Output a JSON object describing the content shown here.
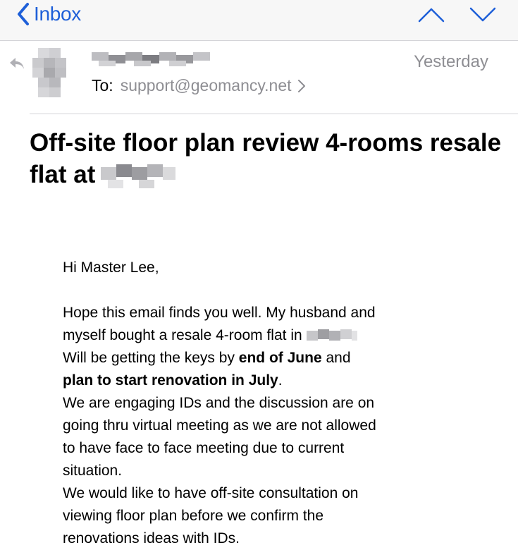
{
  "nav": {
    "back_label": "Inbox"
  },
  "header": {
    "timestamp": "Yesterday",
    "to_label": "To:",
    "to_address": "support@geomancy.net"
  },
  "subject": {
    "text": "Off-site floor plan review 4-rooms resale flat at"
  },
  "body": {
    "greeting": "Hi Master Lee,",
    "line1": "Hope this email finds you well. My husband and",
    "line2": "myself bought a resale 4-room flat in",
    "line3_pre": "Will be getting the keys by ",
    "line3_bold": "end of June",
    "line3_post": " and",
    "line4_bold": "plan to start renovation in July",
    "line4_post": ".",
    "line5": "We are engaging IDs and the discussion are on",
    "line6": "going thru virtual meeting as we are not allowed",
    "line7": "to have face to face meeting due to current",
    "line8": "situation.",
    "line9": "We would like to have off-site consultation on",
    "line10": "viewing floor plan before we confirm the",
    "line11": "renovations ideas with IDs."
  },
  "colors": {
    "accent": "#1e5fd8",
    "secondary_text": "#8e8e93",
    "nav_background": "#f7f7f7"
  }
}
